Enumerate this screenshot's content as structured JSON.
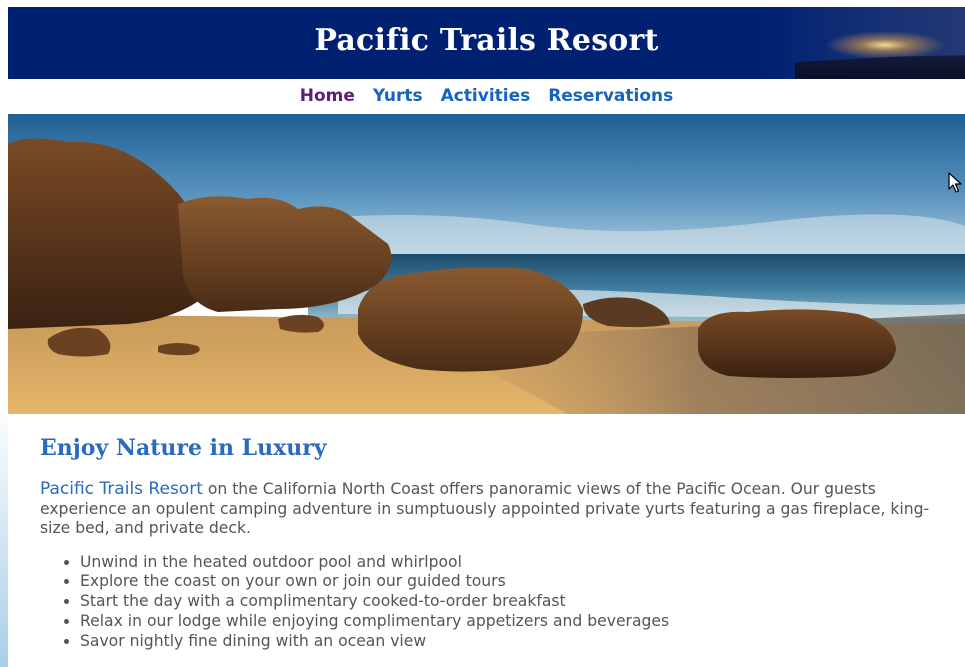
{
  "header": {
    "title": "Pacific Trails Resort"
  },
  "nav": {
    "items": [
      {
        "label": "Home"
      },
      {
        "label": "Yurts"
      },
      {
        "label": "Activities"
      },
      {
        "label": "Reservations"
      }
    ]
  },
  "hero": {
    "image": "coastal-beach-rocks-photo"
  },
  "main": {
    "heading": "Enjoy Nature in Luxury",
    "intro_resort_name": "Pacific Trails Resort",
    "intro_text": " on the California North Coast offers panoramic views of the Pacific Ocean. Our guests experience an opulent camping adventure in sumptuously appointed private yurts featuring a gas fireplace, king-size bed, and private deck.",
    "features": [
      "Unwind in the heated outdoor pool and whirlpool",
      "Explore the coast on your own or join our guided tours",
      "Start the day with a complimentary cooked-to-order breakfast",
      "Relax in our lodge while enjoying complimentary appetizers and beverages",
      "Savor nightly fine dining with an ocean view"
    ]
  },
  "colors": {
    "header_bg": "#002171",
    "nav_link": "#1565c0",
    "nav_visited": "#5c1e7c",
    "heading": "#2a6bbf",
    "body_text": "#555555"
  },
  "icons": {
    "cursor": "mouse-pointer-icon"
  }
}
